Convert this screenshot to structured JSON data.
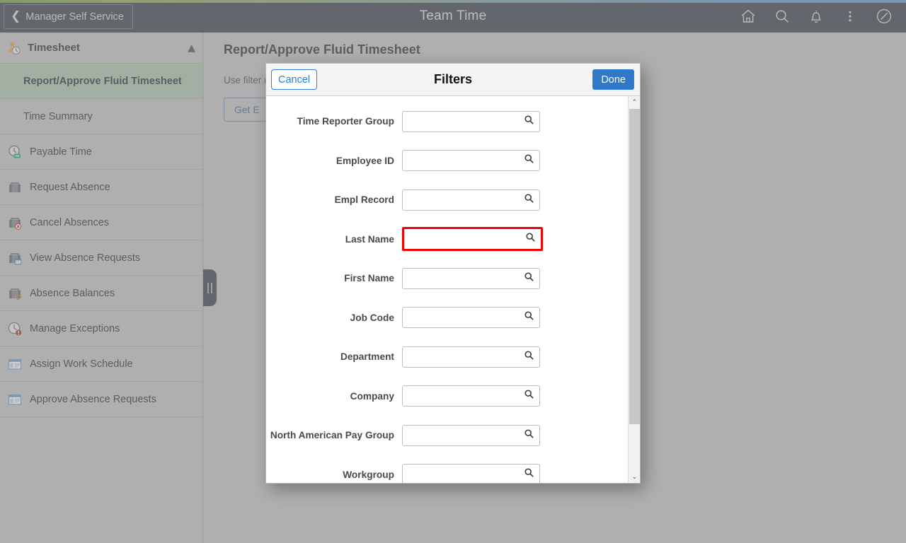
{
  "header": {
    "back_label": "Manager Self Service",
    "title": "Team Time",
    "icons": [
      {
        "name": "home-icon",
        "label": "Home"
      },
      {
        "name": "search-icon",
        "label": "Search"
      },
      {
        "name": "bell-icon",
        "label": "Notifications"
      },
      {
        "name": "actions-icon",
        "label": "Actions"
      },
      {
        "name": "navbar-icon",
        "label": "NavBar"
      }
    ]
  },
  "sidebar": {
    "group_title": "Timesheet",
    "collapse_chevron": "⌃",
    "items": [
      {
        "label": "Report/Approve Fluid Timesheet",
        "icon": "none",
        "selected": true,
        "sub": true
      },
      {
        "label": "Time Summary",
        "icon": "none",
        "selected": false,
        "sub": true
      },
      {
        "label": "Payable Time",
        "icon": "clock-money-icon",
        "selected": false,
        "sub": false
      },
      {
        "label": "Request Absence",
        "icon": "briefcase-icon",
        "selected": false,
        "sub": false
      },
      {
        "label": "Cancel Absences",
        "icon": "briefcase-cancel-icon",
        "selected": false,
        "sub": false
      },
      {
        "label": "View Absence Requests",
        "icon": "briefcase-calendar-icon",
        "selected": false,
        "sub": false
      },
      {
        "label": "Absence Balances",
        "icon": "briefcase-balance-icon",
        "selected": false,
        "sub": false
      },
      {
        "label": "Manage Exceptions",
        "icon": "clock-alert-icon",
        "selected": false,
        "sub": false
      },
      {
        "label": "Assign Work Schedule",
        "icon": "window-icon",
        "selected": false,
        "sub": false
      },
      {
        "label": "Approve Absence Requests",
        "icon": "window-icon",
        "selected": false,
        "sub": false
      }
    ]
  },
  "main": {
    "page_title": "Report/Approve Fluid Timesheet",
    "instruction": "Use filter                                                                                            rch Options.",
    "get_employees_label": "Get E"
  },
  "modal": {
    "title": "Filters",
    "cancel_label": "Cancel",
    "done_label": "Done",
    "fields": [
      {
        "label": "Time Reporter Group",
        "value": "",
        "placeholder": "",
        "highlight": false
      },
      {
        "label": "Employee ID",
        "value": "",
        "placeholder": "",
        "highlight": false
      },
      {
        "label": "Empl Record",
        "value": "",
        "placeholder": "",
        "highlight": false
      },
      {
        "label": "Last Name",
        "value": "",
        "placeholder": "",
        "highlight": true
      },
      {
        "label": "First Name",
        "value": "",
        "placeholder": "",
        "highlight": false
      },
      {
        "label": "Job Code",
        "value": "",
        "placeholder": "",
        "highlight": false
      },
      {
        "label": "Department",
        "value": "",
        "placeholder": "",
        "highlight": false
      },
      {
        "label": "Company",
        "value": "",
        "placeholder": "",
        "highlight": false
      },
      {
        "label": "North American Pay Group",
        "value": "",
        "placeholder": "",
        "highlight": false
      },
      {
        "label": "Workgroup",
        "value": "",
        "placeholder": "",
        "highlight": false
      }
    ],
    "scrollbar": {
      "up_arrow": "⌃",
      "down_arrow": "⌄"
    }
  },
  "colors": {
    "header_bg": "#4b5059",
    "sidebar_bg": "#c6c6c6",
    "selected_item_bg": "#b2c6b2",
    "accent_blue": "#3278c8",
    "highlight_red": "#f20000"
  }
}
